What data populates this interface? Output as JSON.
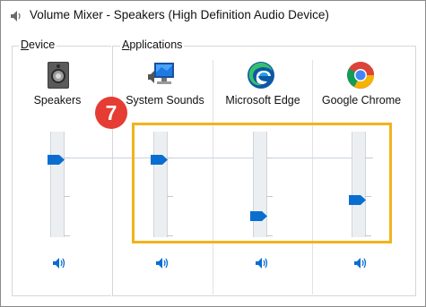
{
  "window": {
    "title": "Volume Mixer - Speakers (High Definition Audio Device)"
  },
  "groups": {
    "device_label": "Device",
    "device_accel": "D",
    "device_rest": "evice",
    "apps_label": "Applications",
    "apps_accel": "A",
    "apps_rest": "pplications"
  },
  "device": {
    "name": "Speakers",
    "icon": "speaker-device-icon",
    "volume": 0.75
  },
  "apps": [
    {
      "name": "System Sounds",
      "icon": "system-sounds-icon",
      "volume": 0.75
    },
    {
      "name": "Microsoft Edge",
      "icon": "edge-icon",
      "volume": 0.2
    },
    {
      "name": "Google Chrome",
      "icon": "chrome-icon",
      "volume": 0.4
    }
  ],
  "annotation": {
    "badge": "7",
    "highlight_color": "#f2b31c",
    "badge_color": "#e53c33"
  },
  "colors": {
    "thumb": "#0a6ed1",
    "track": "#eceff2"
  }
}
